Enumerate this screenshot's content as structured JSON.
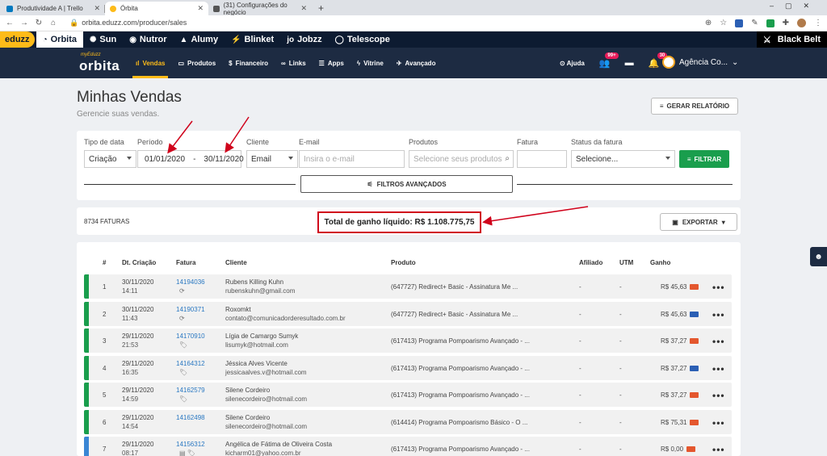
{
  "browser": {
    "tabs": [
      {
        "title": "Produtividade A | Trello",
        "color": "#0079bf"
      },
      {
        "title": "Órbita",
        "color": "#fdbb19"
      },
      {
        "title": "(31) Configurações do negócio",
        "color": "#555555"
      }
    ],
    "url": "orbita.eduzz.com/producer/sales"
  },
  "products_bar": {
    "logo": "eduzz",
    "items": [
      "Orbita",
      "Sun",
      "Nutror",
      "Alumy",
      "Blinket",
      "Jobzz",
      "Telescope"
    ],
    "blackbelt": "Black Belt"
  },
  "header": {
    "logo_small": "myEduzz",
    "logo_big": "orbita",
    "menu": [
      "Vendas",
      "Produtos",
      "Financeiro",
      "Links",
      "Apps",
      "Vitrine",
      "Avançado"
    ],
    "help": "Ajuda",
    "badge_users": "99+",
    "badge_bell": "30",
    "account": "Agência Co..."
  },
  "page": {
    "title": "Minhas Vendas",
    "subtitle": "Gerencie suas vendas.",
    "report_button": "GERAR RELATÓRIO"
  },
  "filters": {
    "tipo_label": "Tipo de data",
    "tipo_value": "Criação",
    "periodo_label": "Período",
    "date_from": "01/01/2020",
    "date_sep": "-",
    "date_to": "30/11/2020",
    "cliente_label": "Cliente",
    "cliente_value": "Email",
    "email_label": "E-mail",
    "email_placeholder": "Insira o e-mail",
    "produtos_label": "Produtos",
    "produtos_placeholder": "Selecione seus produtos",
    "fatura_label": "Fatura",
    "status_label": "Status da fatura",
    "status_value": "Selecione...",
    "filter_button": "FILTRAR",
    "advanced_button": "FILTROS AVANÇADOS"
  },
  "summary": {
    "count": "8734 FATURAS",
    "total": "Total de ganho líquido: R$ 1.108.775,75",
    "export_button": "EXPORTAR"
  },
  "table": {
    "headers": [
      "#",
      "Dt. Criação",
      "Fatura",
      "Cliente",
      "Produto",
      "Afiliado",
      "UTM",
      "Ganho"
    ],
    "rows": [
      {
        "n": "1",
        "date": "30/11/2020",
        "time": "14:11",
        "invoice": "14194036",
        "sub": "⟳",
        "client": "Rubens Killing Kuhn",
        "email": "rubenskuhn@gmail.com",
        "product": "(647727) Redirect+ Basic - Assinatura Me ...",
        "affiliate": "-",
        "utm": "-",
        "gain": "R$ 45,63",
        "status_color": "#1a9e4d",
        "card_color": "#e4572e"
      },
      {
        "n": "2",
        "date": "30/11/2020",
        "time": "11:43",
        "invoice": "14190371",
        "sub": "⟳",
        "client": "Roxomkt",
        "email": "contato@comunicadorderesultado.com.br",
        "product": "(647727) Redirect+ Basic - Assinatura Me ...",
        "affiliate": "-",
        "utm": "-",
        "gain": "R$ 45,63",
        "status_color": "#1a9e4d",
        "card_color": "#2b5fb4"
      },
      {
        "n": "3",
        "date": "29/11/2020",
        "time": "21:53",
        "invoice": "14170910",
        "sub": "🏷",
        "client": "Lígia de Camargo Sumyk",
        "email": "lisumyk@hotmail.com",
        "product": "(617413) Programa Pompoarismo Avançado - ...",
        "affiliate": "-",
        "utm": "-",
        "gain": "R$ 37,27",
        "status_color": "#1a9e4d",
        "card_color": "#e4572e"
      },
      {
        "n": "4",
        "date": "29/11/2020",
        "time": "16:35",
        "invoice": "14164312",
        "sub": "🏷",
        "client": "Jéssica Alves Vicente",
        "email": "jessicaalves.v@hotmail.com",
        "product": "(617413) Programa Pompoarismo Avançado - ...",
        "affiliate": "-",
        "utm": "-",
        "gain": "R$ 37,27",
        "status_color": "#1a9e4d",
        "card_color": "#2b5fb4"
      },
      {
        "n": "5",
        "date": "29/11/2020",
        "time": "14:59",
        "invoice": "14162579",
        "sub": "🏷",
        "client": "Silene Cordeiro",
        "email": "silenecordeiro@hotmail.com",
        "product": "(617413) Programa Pompoarismo Avançado - ...",
        "affiliate": "-",
        "utm": "-",
        "gain": "R$ 37,27",
        "status_color": "#1a9e4d",
        "card_color": "#e4572e"
      },
      {
        "n": "6",
        "date": "29/11/2020",
        "time": "14:54",
        "invoice": "14162498",
        "sub": "",
        "client": "Silene Cordeiro",
        "email": "silenecordeiro@hotmail.com",
        "product": "(614414) Programa Pompoarismo Básico - O ...",
        "affiliate": "-",
        "utm": "-",
        "gain": "R$ 75,31",
        "status_color": "#1a9e4d",
        "card_color": "#e4572e"
      },
      {
        "n": "7",
        "date": "29/11/2020",
        "time": "08:17",
        "invoice": "14156312",
        "sub": "▤ 🏷",
        "client": "Angélica de Fátima de Oliveira Costa",
        "email": "kicharm01@yahoo.com.br",
        "product": "(617413) Programa Pompoarismo Avançado - ...",
        "affiliate": "-",
        "utm": "-",
        "gain": "R$ 0,00",
        "status_color": "#3a86d4",
        "card_color": "#e4572e"
      }
    ]
  },
  "colors": {
    "accent": "#fdbb19",
    "navy": "#1d2b42",
    "green": "#1a9e4d",
    "annotation": "#d0021b"
  }
}
